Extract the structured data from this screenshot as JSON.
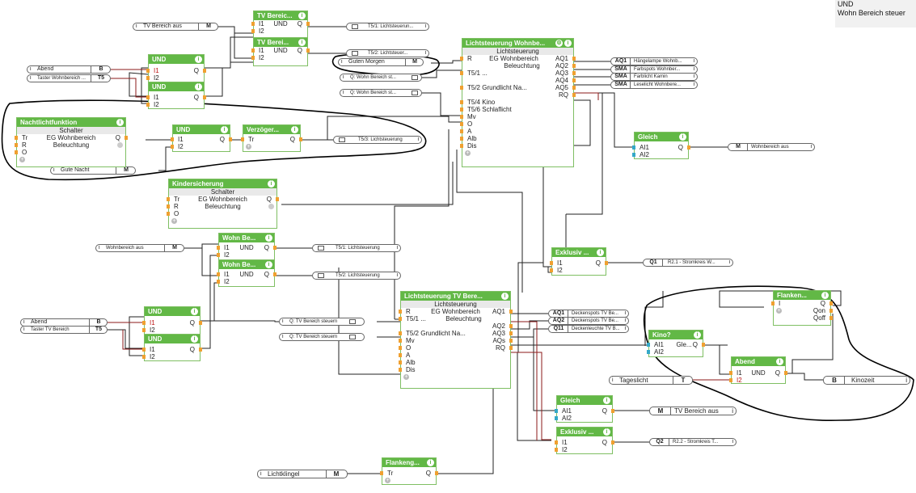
{
  "tooltip": {
    "lines": [
      "UND",
      "Wohn Bereich steuer"
    ]
  },
  "info_icon": "i",
  "plus_icon": "+",
  "colors": {
    "block_header": "#62b846",
    "input_pin": "#f0a030",
    "analog_pin": "#34a8c8",
    "wire": "#222222",
    "wire_red": "#8b1a1a",
    "annotation": "#000000"
  },
  "blocks": {
    "tv_bereich_1": {
      "title": "TV  Bereic...",
      "mid": "UND",
      "p1": "I1",
      "p2": "I2",
      "q": "Q"
    },
    "tv_bereich_2": {
      "title": "TV  Berei...",
      "mid": "UND",
      "p1": "I1",
      "p2": "I2",
      "q": "Q"
    },
    "und_top_1": {
      "title": "UND",
      "p1": "I1",
      "p2": "I2",
      "q": "Q"
    },
    "und_top_2": {
      "title": "UND",
      "p1": "I1",
      "p2": "I2",
      "q": "Q"
    },
    "lichtsteuerung_wohn": {
      "title": "Lichtsteuerung  Wohnbe...",
      "sub": "Lichtsteuerung",
      "r": "R",
      "l1": "EG Wohnbereich",
      "l2": "Beleuchtung",
      "t51": "T5/1 ...",
      "t52": "T5/2 Grundlicht Na...",
      "t54": "T5/4 Kino",
      "t56": "T5/6 Schlaflicht",
      "mv": "Mv",
      "o": "O",
      "a": "A",
      "alb": "Alb",
      "dis": "Dis",
      "aq1": "AQ1",
      "aq2": "AQ2",
      "aq3": "AQ3",
      "aq4": "AQ4",
      "aq5": "AQ5",
      "rq": "RQ"
    },
    "nachtlicht": {
      "title": "Nachtlichtfunktion",
      "sub": "Schalter",
      "tr": "Tr",
      "r": "R",
      "o": "O",
      "l1": "EG Wohnbereich",
      "l2": "Beleuchtung",
      "q": "Q"
    },
    "und_nacht": {
      "title": "UND",
      "p1": "I1",
      "p2": "I2",
      "q": "Q"
    },
    "verzoeger": {
      "title": "Verzöger...",
      "tr": "Tr",
      "q": "Q"
    },
    "gleich_top": {
      "title": "Gleich",
      "p1": "AI1",
      "p2": "AI2",
      "q": "Q"
    },
    "kindersicherung": {
      "title": "Kindersicherung",
      "sub": "Schalter",
      "tr": "Tr",
      "r": "R",
      "o": "O",
      "l1": "EG Wohnbereich",
      "l2": "Beleuchtung",
      "q": "Q"
    },
    "wohn_be_1": {
      "title": "Wohn  Be...",
      "mid": "UND",
      "p1": "I1",
      "p2": "I2",
      "q": "Q"
    },
    "wohn_be_2": {
      "title": "Wohn  Be...",
      "mid": "UND",
      "p1": "I1",
      "p2": "I2",
      "q": "Q"
    },
    "und_mid_1": {
      "title": "UND",
      "p1": "I1",
      "p2": "I2",
      "q": "Q"
    },
    "und_mid_2": {
      "title": "UND",
      "p1": "I1",
      "p2": "I2",
      "q": "Q"
    },
    "lichtsteuerung_tv": {
      "title": "Lichtsteuerung  TV  Bere...",
      "sub": "Lichtsteuerung",
      "r": "R",
      "l1": "EG Wohnbereich",
      "l2": "Beleuchtung",
      "t51": "T5/1 ...",
      "t52": "T5/2 Grundlicht Na...",
      "mv": "Mv",
      "o": "O",
      "a": "A",
      "alb": "Alb",
      "dis": "Dis",
      "aq1": "AQ1",
      "aq2": "AQ2",
      "aq3": "AQ3",
      "aqs": "AQs",
      "rq": "RQ"
    },
    "exklusiv_1": {
      "title": "Exklusiv ...",
      "p1": "I1",
      "p2": "I2",
      "q": "Q"
    },
    "exklusiv_2": {
      "title": "Exklusiv ...",
      "p1": "I1",
      "p2": "I2",
      "q": "Q"
    },
    "gleich_bot": {
      "title": "Gleich",
      "p1": "AI1",
      "p2": "AI2",
      "q": "Q"
    },
    "flanken_right": {
      "title": "Flanken...",
      "p1": "I",
      "q": "Q",
      "qon": "Qon",
      "qoff": "Qoff"
    },
    "kino": {
      "title": "Kino?",
      "p1": "AI1",
      "p2": "AI2",
      "mid": "Gle...",
      "q": "Q"
    },
    "abend_right": {
      "title": "Abend",
      "p1": "I1",
      "p2": "I2",
      "mid": "UND",
      "q": "Q"
    },
    "flankeng_bot": {
      "title": "Flankeng...",
      "tr": "Tr",
      "q": "Q"
    }
  },
  "io": {
    "tv_bereich_aus_in": {
      "label": "TV  Bereich  aus",
      "box": "M"
    },
    "abend_top": {
      "label": "Abend",
      "box": "B"
    },
    "taster_wohn": {
      "label": "Taster  Wohnbereich ...",
      "box": "T5"
    },
    "gute_morgen": {
      "label": "Guten  Morgen",
      "box": "M"
    },
    "t51_out_top": {
      "label": "T5/1:  Lichtsteuerun..."
    },
    "t52_out_top": {
      "label": "T5/2:  Lichtsteuer..."
    },
    "q_wohn_1": {
      "label": "Q:  Wohn  Bereich  st..."
    },
    "q_wohn_2": {
      "label": "Q:  Wohn  Bereich  st..."
    },
    "gute_nacht": {
      "label": "Gute  Nacht",
      "box": "M"
    },
    "t53_out": {
      "label": "T5/3:  Lichtsteuerung"
    },
    "aq1_out": {
      "box": "AQ1",
      "label": "Hängelampe  Wohnb..."
    },
    "sma_1": {
      "box": "SMA",
      "label": "Farbspots  Wohnber..."
    },
    "sma_2": {
      "box": "SMA",
      "label": "Farblicht  Kamin"
    },
    "sma_3": {
      "box": "SMA",
      "label": "Leselicht  Wohnbere..."
    },
    "wohnbereich_aus_out": {
      "box": "M",
      "label": "Wohnbereich  aus"
    },
    "wohnbereich_aus_in": {
      "label": "Wohnbereich  aus",
      "box": "M"
    },
    "t51_out_mid": {
      "label": "T5/1:  Lichtsteuerung"
    },
    "t52_out_mid": {
      "label": "T5/2:  Lichtsteuerung"
    },
    "abend_mid": {
      "label": "Abend",
      "box": "B"
    },
    "taster_tv": {
      "label": "Taster  TV  Bereich",
      "box": "T5"
    },
    "q_tv_1": {
      "label": "Q:  TV  Bereich  steuern"
    },
    "q_tv_2": {
      "label": "Q:  TV  Bereich  steuern"
    },
    "q1_out": {
      "box": "Q1",
      "label": "R2.1  -  Stromkreis  W..."
    },
    "aq1_tv": {
      "box": "AQ1",
      "label": "Deckenspots  TV  Be..."
    },
    "aq2_tv": {
      "box": "AQ2",
      "label": "Deckenspots  TV  Be..."
    },
    "q11_tv": {
      "box": "Q11",
      "label": "Deckenleuchte  TV  B..."
    },
    "tageslicht": {
      "label": "Tageslicht",
      "box": "T"
    },
    "kinozeit": {
      "box": "B",
      "label": "Kinozeit"
    },
    "tv_bereich_aus_out": {
      "box": "M",
      "label": "TV  Bereich  aus"
    },
    "q2_out": {
      "box": "Q2",
      "label": "R2.2  -  Stromkreis  T..."
    },
    "lichtklingel": {
      "label": "Lichtklingel",
      "box": "M"
    }
  }
}
